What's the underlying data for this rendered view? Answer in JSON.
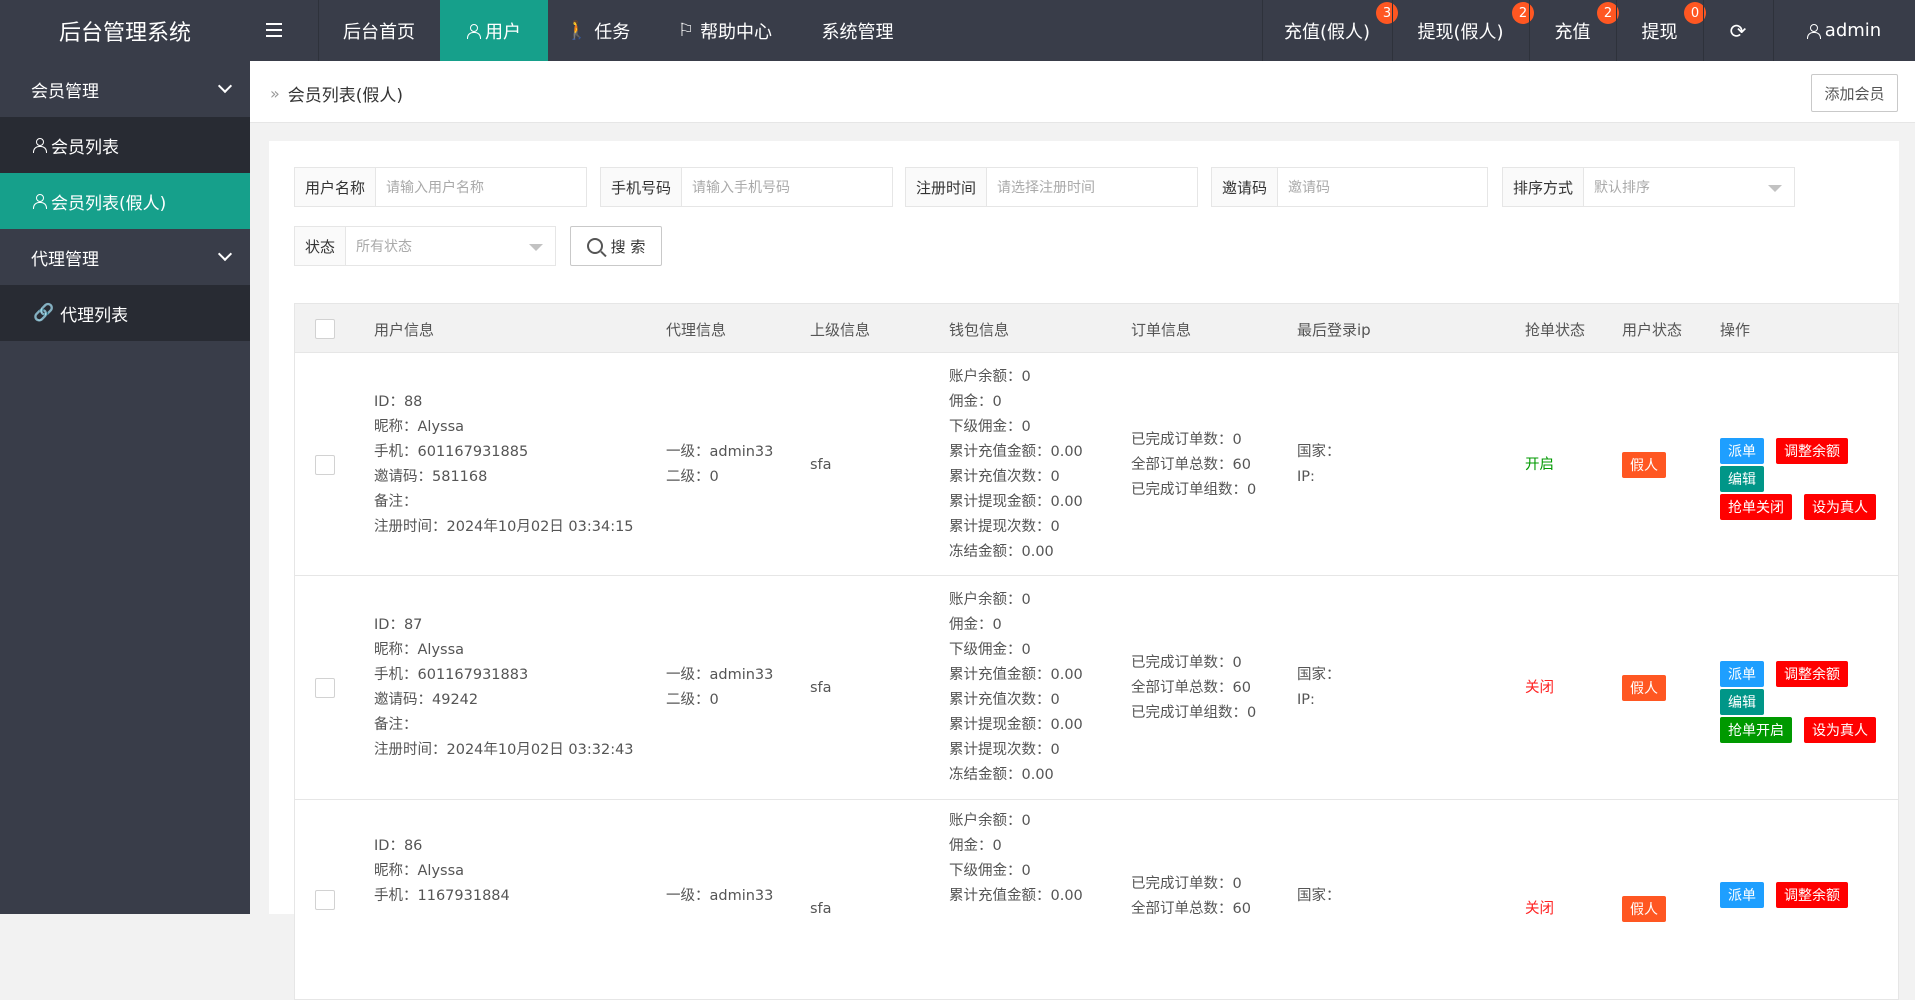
{
  "app": {
    "title": "后台管理系统"
  },
  "topnav": {
    "items": [
      "后台首页",
      "用户",
      "任务",
      "帮助中心",
      "系统管理"
    ],
    "right": [
      {
        "label": "充值(假人)",
        "badge": "3"
      },
      {
        "label": "提现(假人)",
        "badge": "2"
      },
      {
        "label": "充值",
        "badge": "2"
      },
      {
        "label": "提现",
        "badge": "0"
      }
    ],
    "user": "admin"
  },
  "sidebar": {
    "groups": [
      {
        "label": "会员管理",
        "items": [
          "会员列表",
          "会员列表(假人)"
        ]
      },
      {
        "label": "代理管理",
        "items": [
          "代理列表"
        ]
      }
    ]
  },
  "breadcrumb": {
    "current": "会员列表(假人)"
  },
  "add_button": "添加会员",
  "filters": {
    "username": {
      "label": "用户名称",
      "placeholder": "请输入用户名称"
    },
    "phone": {
      "label": "手机号码",
      "placeholder": "请输入手机号码"
    },
    "reg_time": {
      "label": "注册时间",
      "placeholder": "请选择注册时间"
    },
    "invite": {
      "label": "邀请码",
      "placeholder": "邀请码"
    },
    "sort": {
      "label": "排序方式",
      "value": "默认排序"
    },
    "status": {
      "label": "状态",
      "value": "所有状态"
    },
    "search_label": "搜 索"
  },
  "table": {
    "headers": [
      "用户信息",
      "代理信息",
      "上级信息",
      "钱包信息",
      "订单信息",
      "最后登录ip",
      "抢单状态",
      "用户状态",
      "操作"
    ],
    "rows": [
      {
        "user": [
          "ID：88",
          "昵称：Alyssa",
          "手机：601167931885",
          "邀请码：581168",
          "备注：",
          "注册时间：2024年10月02日 03:34:15"
        ],
        "agent": [
          "一级：admin33",
          "二级：0"
        ],
        "parent": "sfa",
        "wallet": [
          "账户余额：0",
          "佣金：0",
          "下级佣金：0",
          "累计充值金额：0.00",
          "累计充值次数：0",
          "累计提现金额：0.00",
          "累计提现次数：0",
          "冻结金额：0.00"
        ],
        "orders": [
          "已完成订单数：0",
          "全部订单总数：60",
          "已完成订单组数：0"
        ],
        "ip": [
          "国家：",
          "IP:"
        ],
        "grab_status": "开启",
        "user_status": "假人",
        "actions": [
          "派单",
          "调整余额",
          "编辑",
          "抢单关闭",
          "设为真人"
        ]
      },
      {
        "user": [
          "ID：87",
          "昵称：Alyssa",
          "手机：601167931883",
          "邀请码：49242",
          "备注：",
          "注册时间：2024年10月02日 03:32:43"
        ],
        "agent": [
          "一级：admin33",
          "二级：0"
        ],
        "parent": "sfa",
        "wallet": [
          "账户余额：0",
          "佣金：0",
          "下级佣金：0",
          "累计充值金额：0.00",
          "累计充值次数：0",
          "累计提现金额：0.00",
          "累计提现次数：0",
          "冻结金额：0.00"
        ],
        "orders": [
          "已完成订单数：0",
          "全部订单总数：60",
          "已完成订单组数：0"
        ],
        "ip": [
          "国家：",
          "IP:"
        ],
        "grab_status": "关闭",
        "user_status": "假人",
        "actions": [
          "派单",
          "调整余额",
          "编辑",
          "抢单开启",
          "设为真人"
        ]
      },
      {
        "user": [
          "ID：86",
          "昵称：Alyssa",
          "手机：1167931884"
        ],
        "agent": [
          "一级：admin33"
        ],
        "parent": "sfa",
        "wallet": [
          "账户余额：0",
          "佣金：0",
          "下级佣金：0",
          "累计充值金额：0.00"
        ],
        "orders": [
          "已完成订单数：0",
          "全部订单总数：60"
        ],
        "ip": [
          "国家："
        ],
        "grab_status": "关闭",
        "user_status": "假人",
        "actions": [
          "派单",
          "调整余额"
        ]
      }
    ]
  },
  "colors": {
    "topbar": "#393d49",
    "accent": "#16a08b",
    "badge": "#ff5722"
  }
}
